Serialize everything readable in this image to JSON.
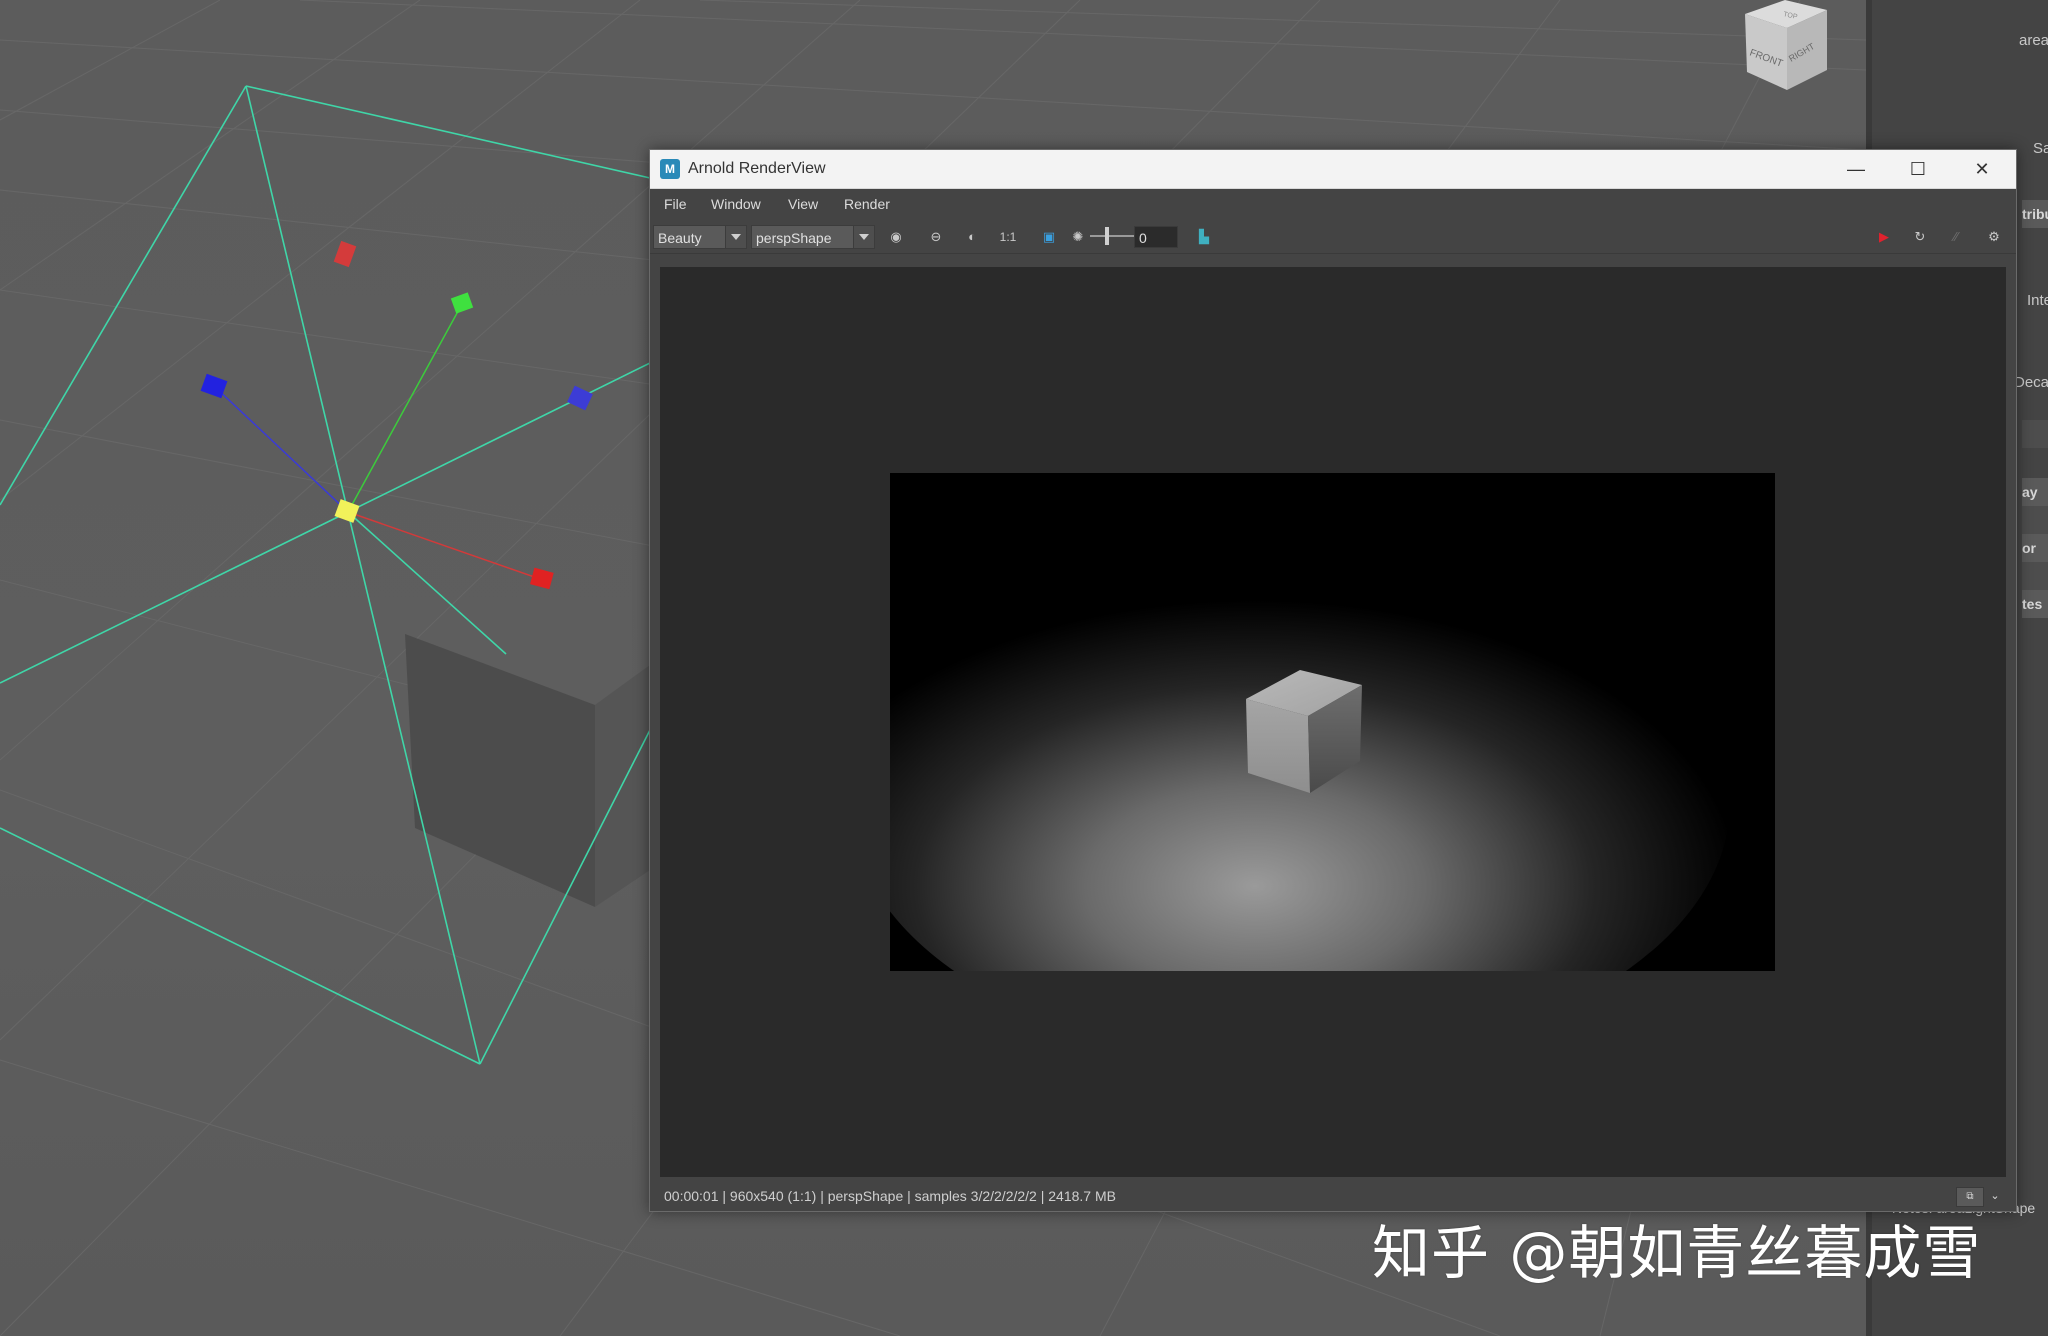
{
  "window": {
    "title": "Arnold RenderView",
    "minimize": "—",
    "maximize": "☐",
    "close": "✕"
  },
  "menu": [
    "File",
    "Window",
    "View",
    "Render"
  ],
  "toolbar": {
    "aov_selected": "Beauty",
    "camera_selected": "perspShape",
    "one_to_one": "1:1",
    "exposure_value": "0"
  },
  "status": {
    "text": "00:00:01 | 960x540 (1:1) | perspShape  | samples 3/2/2/2/2/2 | 2418.7 MB",
    "toggle": "⧉",
    "chevron": "⌄"
  },
  "viewcube": {
    "top": "TOP",
    "front": "FRONT",
    "right": "RIGHT"
  },
  "attribute_editor": {
    "partial_labels": [
      "areaL",
      "Sa",
      "tribu",
      "Inte",
      "Decay",
      "ay",
      "or",
      "tes"
    ],
    "notes": "Notes: areaLightShape"
  },
  "watermark": "知乎 @朝如青丝暮成雪",
  "colors": {
    "viewport_bg": "#5c5c5c",
    "light_frustum": "#3fd6a8",
    "render_bg": "#2a2a2a",
    "render_stop": "#e0222e"
  }
}
